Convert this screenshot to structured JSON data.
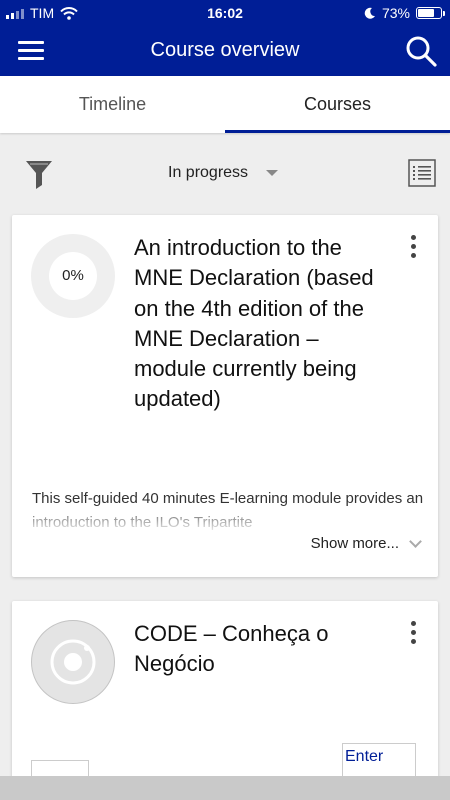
{
  "status_bar": {
    "carrier": "TIM",
    "time": "16:02",
    "battery": "73%",
    "battery_level": 0.73
  },
  "toolbar": {
    "title": "Course overview"
  },
  "tabs": [
    {
      "label": "Timeline",
      "active": false
    },
    {
      "label": "Courses",
      "active": true
    }
  ],
  "filter": {
    "selected": "In progress"
  },
  "courses": [
    {
      "progress": "0%",
      "title": "An introduction to the MNE Declaration (based on the 4th edition of the MNE Declaration – module currently being updated)",
      "summary": "This self-guided 40 minutes E-learning module provides an introduction to the ILO's Tripartite",
      "show_more": "Show more..."
    },
    {
      "title": "CODE – Conheça o Negócio",
      "enter_label": "Enter"
    }
  ],
  "colors": {
    "brand": "#001e96",
    "background": "#eeeeee"
  }
}
